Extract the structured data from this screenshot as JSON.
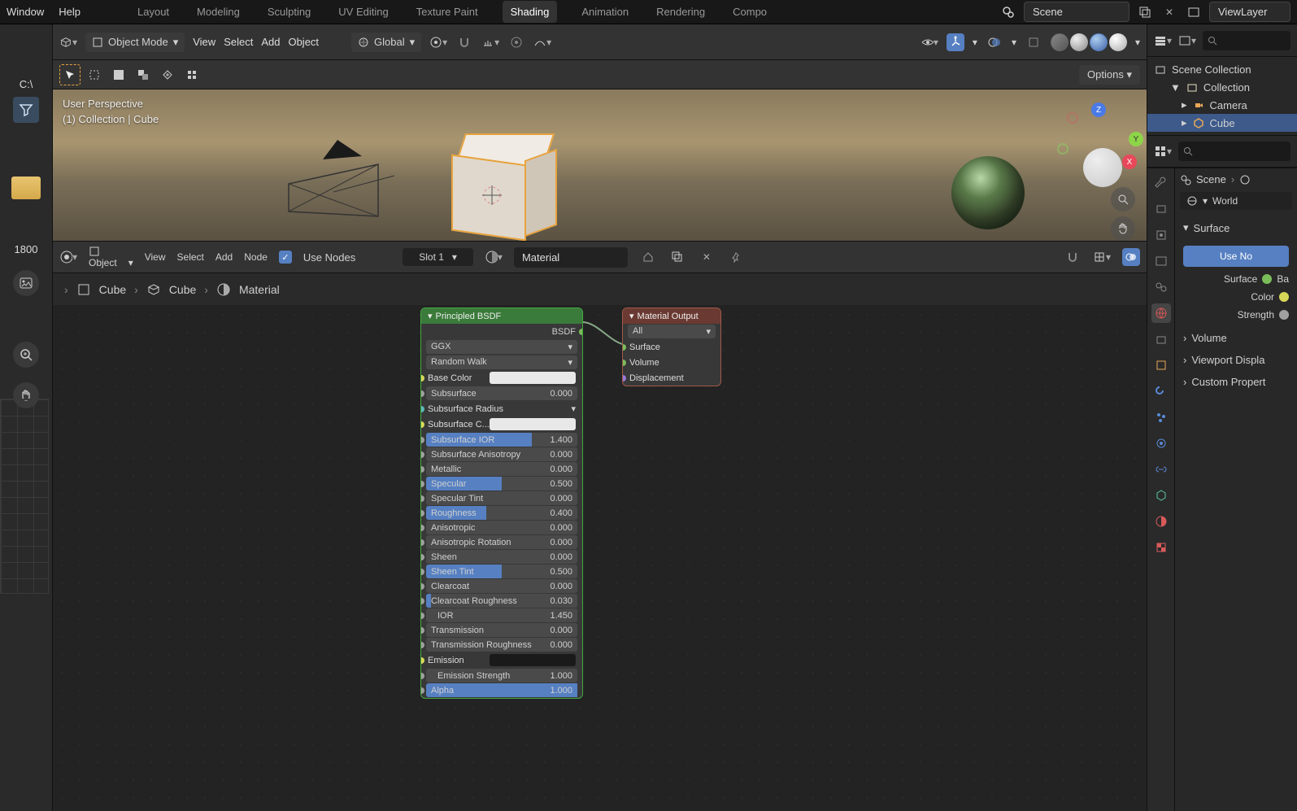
{
  "top_menu": {
    "window": "Window",
    "help": "Help"
  },
  "workspaces": [
    "Layout",
    "Modeling",
    "Sculpting",
    "UV Editing",
    "Texture Paint",
    "Shading",
    "Animation",
    "Rendering",
    "Compo"
  ],
  "active_workspace": "Shading",
  "scene_name": "Scene",
  "view_layer": "ViewLayer",
  "left": {
    "path": "C:\\",
    "num": "1800"
  },
  "vp_header": {
    "mode": "Object Mode",
    "menus": [
      "View",
      "Select",
      "Add",
      "Object"
    ],
    "orient": "Global",
    "options": "Options"
  },
  "vp_overlay": {
    "line1": "User Perspective",
    "line2": "(1) Collection | Cube"
  },
  "axes": {
    "x": "X",
    "y": "Y",
    "z": "Z"
  },
  "node_header": {
    "mode": "Object",
    "menus": [
      "View",
      "Select",
      "Add",
      "Node"
    ],
    "use_nodes": "Use Nodes",
    "slot": "Slot 1",
    "material": "Material"
  },
  "breadcrumb": {
    "cube1": "Cube",
    "cube2": "Cube",
    "material": "Material"
  },
  "bsdf": {
    "title": "Principled BSDF",
    "out": "BSDF",
    "distribution": "GGX",
    "sss_method": "Random Walk",
    "base_color": "Base Color",
    "subsurface": {
      "l": "Subsurface",
      "v": "0.000"
    },
    "sss_radius": "Subsurface Radius",
    "sss_color": "Subsurface C...",
    "sss_ior": {
      "l": "Subsurface IOR",
      "v": "1.400",
      "f": 70
    },
    "sss_aniso": {
      "l": "Subsurface Anisotropy",
      "v": "0.000",
      "f": 0
    },
    "metallic": {
      "l": "Metallic",
      "v": "0.000",
      "f": 0
    },
    "specular": {
      "l": "Specular",
      "v": "0.500",
      "f": 50
    },
    "spec_tint": {
      "l": "Specular Tint",
      "v": "0.000",
      "f": 0
    },
    "roughness": {
      "l": "Roughness",
      "v": "0.400",
      "f": 40
    },
    "aniso": {
      "l": "Anisotropic",
      "v": "0.000",
      "f": 0
    },
    "aniso_rot": {
      "l": "Anisotropic Rotation",
      "v": "0.000",
      "f": 0
    },
    "sheen": {
      "l": "Sheen",
      "v": "0.000",
      "f": 0
    },
    "sheen_tint": {
      "l": "Sheen Tint",
      "v": "0.500",
      "f": 50
    },
    "clearcoat": {
      "l": "Clearcoat",
      "v": "0.000",
      "f": 0
    },
    "cc_rough": {
      "l": "Clearcoat Roughness",
      "v": "0.030",
      "f": 3
    },
    "ior": {
      "l": "IOR",
      "v": "1.450",
      "f": 0
    },
    "transmission": {
      "l": "Transmission",
      "v": "0.000",
      "f": 0
    },
    "trans_rough": {
      "l": "Transmission Roughness",
      "v": "0.000",
      "f": 0
    },
    "emission": "Emission",
    "emit_str": {
      "l": "Emission Strength",
      "v": "1.000",
      "f": 0
    },
    "alpha": {
      "l": "Alpha",
      "v": "1.000",
      "f": 100
    }
  },
  "mat_output": {
    "title": "Material Output",
    "target": "All",
    "surface": "Surface",
    "volume": "Volume",
    "displacement": "Displacement"
  },
  "outliner": {
    "scene_collection": "Scene Collection",
    "collection": "Collection",
    "camera": "Camera",
    "cube": "Cube"
  },
  "props": {
    "scene_crumb": "Scene",
    "world": "World",
    "surface": "Surface",
    "use_nodes_btn": "Use No",
    "surface_lbl": "Surface",
    "surface_val": "Ba",
    "color": "Color",
    "strength": "Strength",
    "volume": "Volume",
    "viewport_display": "Viewport Displa",
    "custom_props": "Custom Propert"
  }
}
